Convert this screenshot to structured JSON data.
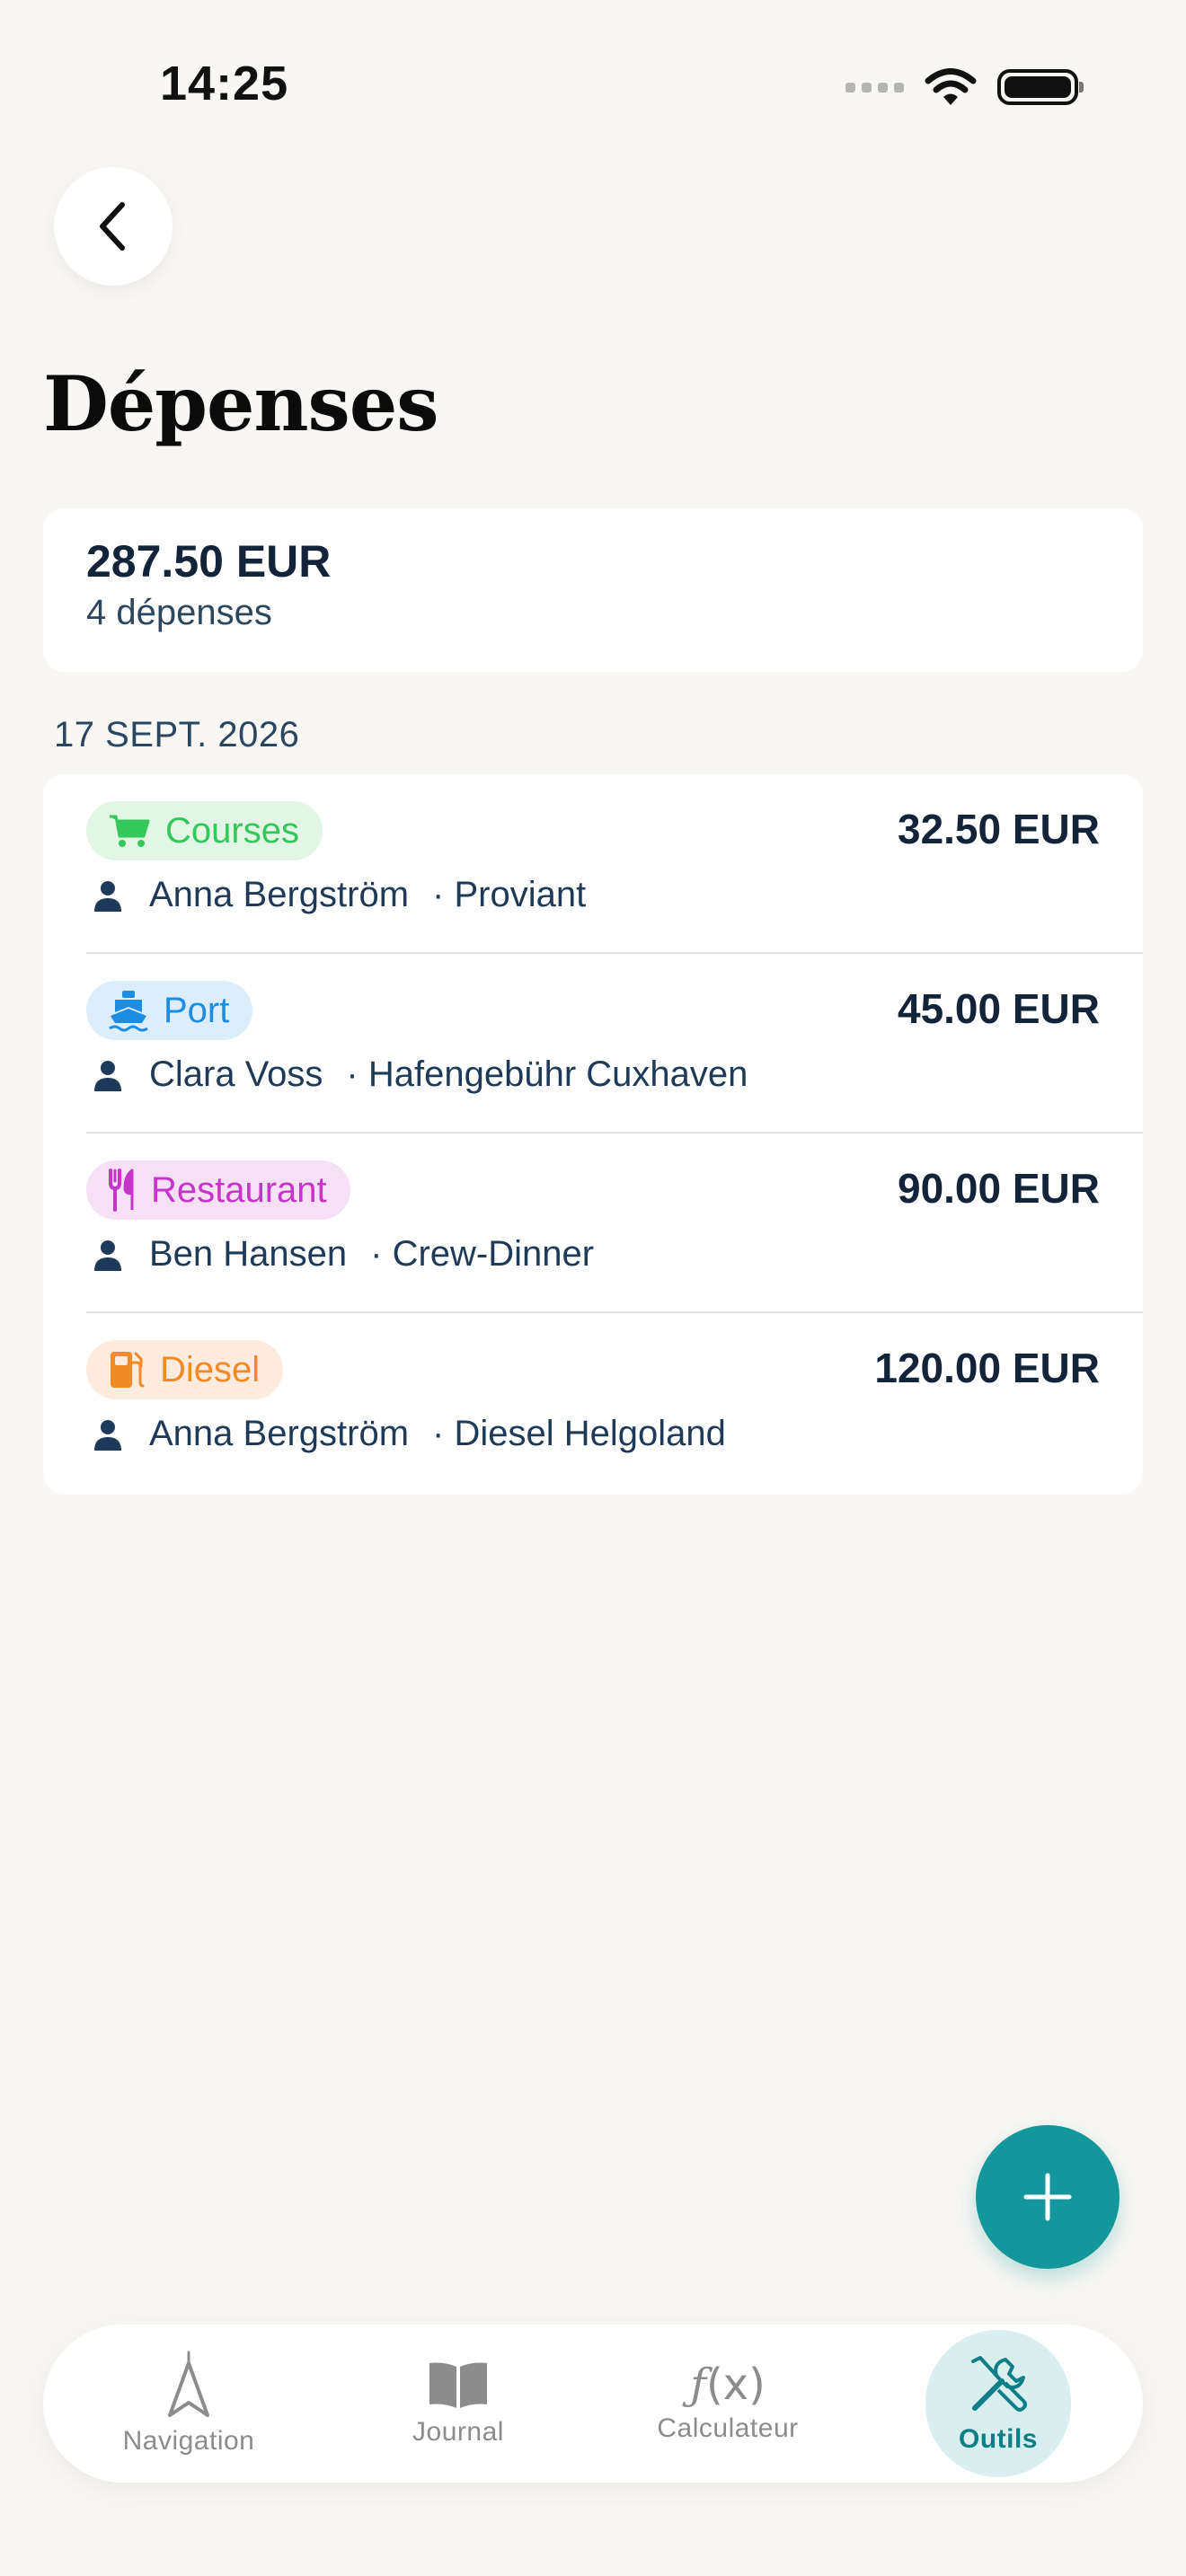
{
  "status_bar": {
    "time": "14:25"
  },
  "header": {
    "title": "Dépenses",
    "back_icon": "chevron-left-icon"
  },
  "summary": {
    "total": "287.50 EUR",
    "count": "4 dépenses"
  },
  "section": {
    "date": "17 SEPT. 2026"
  },
  "expenses": [
    {
      "category": "Courses",
      "icon": "cart-icon",
      "amount": "32.50 EUR",
      "person": "Anna Bergström",
      "description": "· Proviant",
      "color": "#34C759",
      "bg": "#E3F6E6"
    },
    {
      "category": "Port",
      "icon": "ferry-icon",
      "amount": "45.00 EUR",
      "person": "Clara Voss",
      "description": "· Hafengebühr Cuxhaven",
      "color": "#1C8DE0",
      "bg": "#DCEEFB"
    },
    {
      "category": "Restaurant",
      "icon": "fork-knife-icon",
      "amount": "90.00 EUR",
      "person": "Ben Hansen",
      "description": "· Crew-Dinner",
      "color": "#C634C9",
      "bg": "#F6E0F5"
    },
    {
      "category": "Diesel",
      "icon": "fuel-pump-icon",
      "amount": "120.00 EUR",
      "person": "Anna Bergström",
      "description": "· Diesel Helgoland",
      "color": "#F28A26",
      "bg": "#FDEBDD"
    }
  ],
  "fab": {
    "icon": "plus-icon"
  },
  "tabs": [
    {
      "label": "Navigation",
      "icon": "navigation-arrow-icon",
      "active": false
    },
    {
      "label": "Journal",
      "icon": "book-icon",
      "active": false
    },
    {
      "label": "Calculateur",
      "icon": "function-icon",
      "active": false
    },
    {
      "label": "Outils",
      "icon": "tools-icon",
      "active": true
    }
  ],
  "colors": {
    "accent": "#14979A",
    "background": "#F9F7F4"
  }
}
